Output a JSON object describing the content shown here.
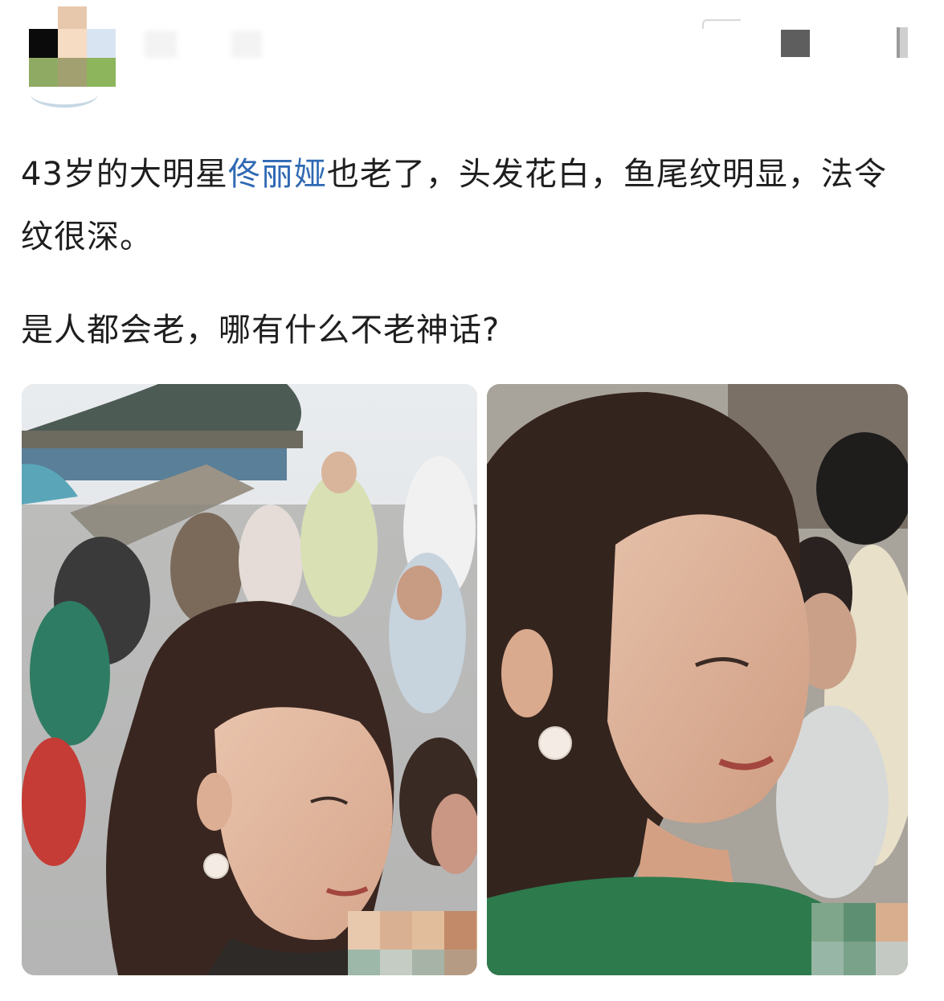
{
  "post": {
    "text_line1_before": "43岁的大明星",
    "mention": "佟丽娅",
    "text_line1_after": "也老了，头发花白，鱼尾纹明显，法令纹很深。",
    "text_para2": "是人都会老，哪有什么不老神话?"
  },
  "colors": {
    "mention": "#2f69b3",
    "text": "#1e1e1e"
  },
  "icons": {
    "more": "more-options-icon"
  }
}
